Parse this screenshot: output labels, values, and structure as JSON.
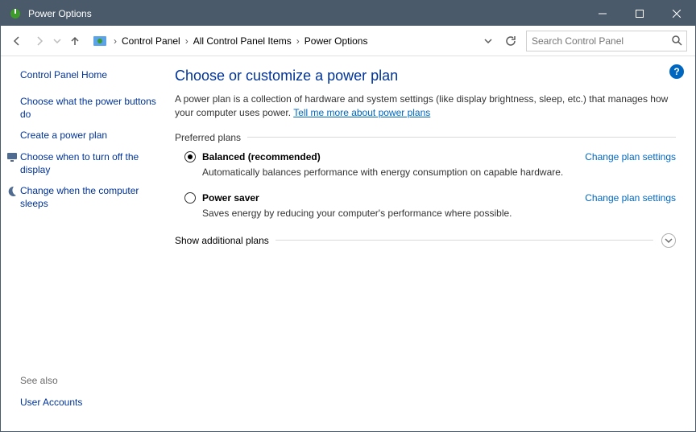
{
  "window": {
    "title": "Power Options"
  },
  "breadcrumb": {
    "seg1": "Control Panel",
    "seg2": "All Control Panel Items",
    "seg3": "Power Options"
  },
  "search": {
    "placeholder": "Search Control Panel"
  },
  "sidebar": {
    "home": "Control Panel Home",
    "links": [
      "Choose what the power buttons do",
      "Create a power plan",
      "Choose when to turn off the display",
      "Change when the computer sleeps"
    ],
    "see_also_label": "See also",
    "see_also_links": [
      "User Accounts"
    ]
  },
  "main": {
    "title": "Choose or customize a power plan",
    "desc_pre": "A power plan is a collection of hardware and system settings (like display brightness, sleep, etc.) that manages how your computer uses power. ",
    "desc_link": "Tell me more about power plans",
    "preferred_label": "Preferred plans",
    "plans": [
      {
        "name": "Balanced (recommended)",
        "desc": "Automatically balances performance with energy consumption on capable hardware.",
        "link": "Change plan settings",
        "checked": true
      },
      {
        "name": "Power saver",
        "desc": "Saves energy by reducing your computer's performance where possible.",
        "link": "Change plan settings",
        "checked": false
      }
    ],
    "additional_label": "Show additional plans"
  },
  "help_badge": "?"
}
